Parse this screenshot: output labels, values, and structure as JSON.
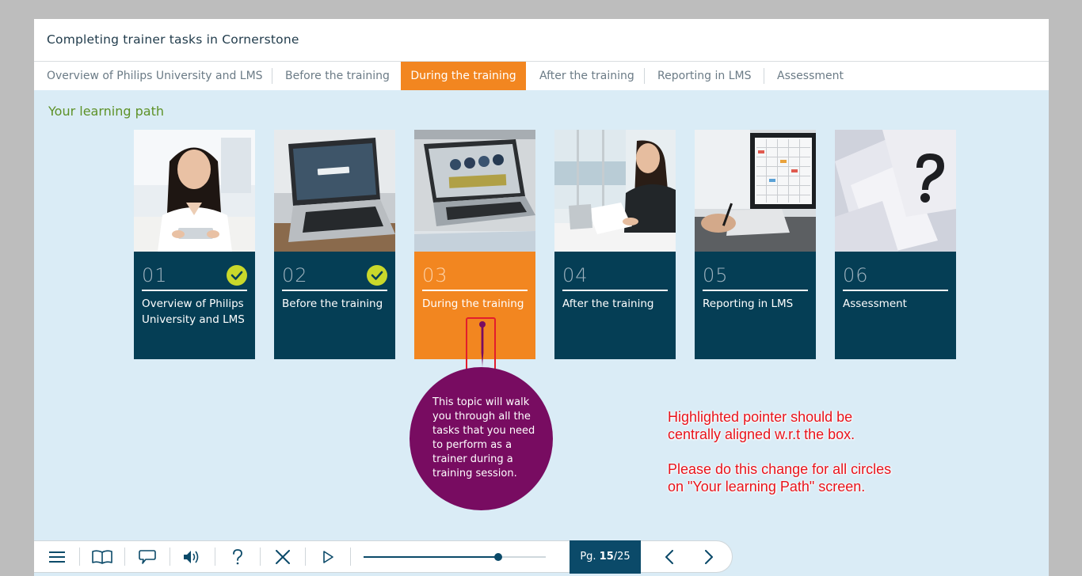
{
  "app": {
    "title": "Completing trainer tasks in Cornerstone"
  },
  "tabs": [
    {
      "label": "Overview of Philips University and LMS",
      "active": false
    },
    {
      "label": "Before the training",
      "active": false
    },
    {
      "label": "During the training",
      "active": true
    },
    {
      "label": "After the training",
      "active": false
    },
    {
      "label": "Reporting in LMS",
      "active": false
    },
    {
      "label": "Assessment",
      "active": false
    }
  ],
  "section": {
    "title": "Your learning path"
  },
  "cards": [
    {
      "number": "01",
      "label": "Overview of Philips University and LMS",
      "completed": true,
      "active": false,
      "image": "woman-with-tablet"
    },
    {
      "number": "02",
      "label": "Before the training",
      "completed": true,
      "active": false,
      "image": "laptop-login"
    },
    {
      "number": "03",
      "label": "During the training",
      "completed": false,
      "active": true,
      "image": "laptop-charts"
    },
    {
      "number": "04",
      "label": "After the training",
      "completed": false,
      "active": false,
      "image": "woman-at-desk"
    },
    {
      "number": "05",
      "label": "Reporting in LMS",
      "completed": false,
      "active": false,
      "image": "calendar-monitor"
    },
    {
      "number": "06",
      "label": "Assessment",
      "completed": false,
      "active": false,
      "image": "question-mark-papers"
    }
  ],
  "tooltip": {
    "text": "This topic will walk you through all the tasks that you need to perform as a trainer during a training session."
  },
  "annotation": {
    "lines": [
      "Highlighted pointer should be",
      "centrally aligned w.r.t the box.",
      "Please do this change for all circles",
      "on \"Your learning Path\" screen."
    ]
  },
  "footer": {
    "icons": [
      "menu-icon",
      "book-icon",
      "comment-icon",
      "audio-icon",
      "help-icon",
      "close-icon",
      "play-icon"
    ],
    "progress": 0.74,
    "page_prefix": "Pg. ",
    "page_current": "15",
    "page_total": "/25",
    "nav_icons": [
      "previous-icon",
      "next-icon"
    ]
  },
  "colors": {
    "accent": "#f28620",
    "card_panel": "#053e55",
    "tooltip": "#780c61",
    "check": "#c9d82b",
    "section_title": "#5d9127",
    "annotation": "#e8131b",
    "page_background": "#daecf6"
  }
}
